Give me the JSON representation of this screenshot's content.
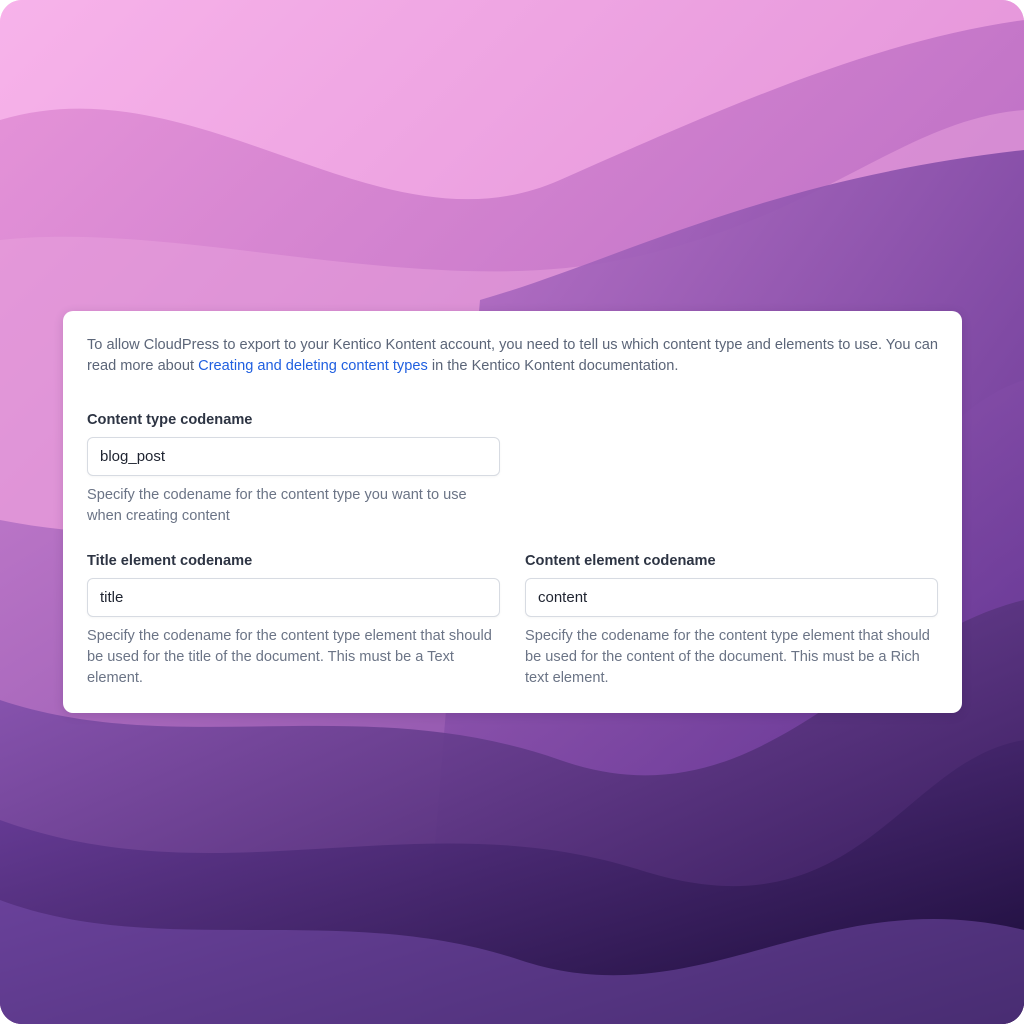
{
  "intro": {
    "text_before": "To allow CloudPress to export to your Kentico Kontent account, you need to tell us which content type and elements to use. You can read more about ",
    "link_text": "Creating and deleting content types",
    "text_after": " in the Kentico Kontent documentation."
  },
  "fields": {
    "content_type": {
      "label": "Content type codename",
      "value": "blog_post",
      "help": "Specify the codename for the content type you want to use when creating content"
    },
    "title_element": {
      "label": "Title element codename",
      "value": "title",
      "help": "Specify the codename for the content type element that should be used for the title of the document. This must be a Text element."
    },
    "content_element": {
      "label": "Content element codename",
      "value": "content",
      "help": "Specify the codename for the content type element that should be used for the content of the document. This must be a Rich text element."
    }
  },
  "colors": {
    "link": "#1f5fe0",
    "background_top": "#f6a9e6",
    "background_bottom": "#1c0c3a"
  }
}
